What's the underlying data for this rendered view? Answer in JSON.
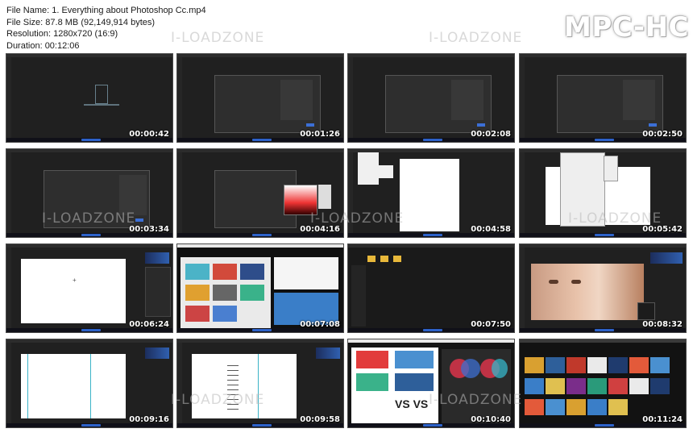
{
  "info": {
    "file_name": "File Name: 1. Everything about Photoshop Cc.mp4",
    "file_size": "File Size: 87.8 MB (92,149,914 bytes)",
    "resolution": "Resolution: 1280x720 (16:9)",
    "duration": "Duration: 00:12:06"
  },
  "brand": "MPC-HC",
  "watermark": "I-LOADZONE",
  "thumbnails": [
    {
      "time": "00:00:42"
    },
    {
      "time": "00:01:26"
    },
    {
      "time": "00:02:08"
    },
    {
      "time": "00:02:50"
    },
    {
      "time": "00:03:34"
    },
    {
      "time": "00:04:16"
    },
    {
      "time": "00:04:58"
    },
    {
      "time": "00:05:42"
    },
    {
      "time": "00:06:24"
    },
    {
      "time": "00:07:08"
    },
    {
      "time": "00:07:50"
    },
    {
      "time": "00:08:32"
    },
    {
      "time": "00:09:16"
    },
    {
      "time": "00:09:58"
    },
    {
      "time": "00:10:40"
    },
    {
      "time": "00:11:24"
    }
  ]
}
